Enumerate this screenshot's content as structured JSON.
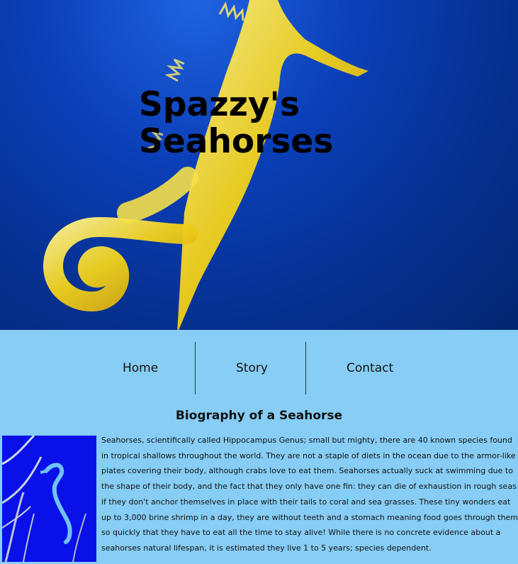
{
  "header": {
    "title_line1": "Spazzy's",
    "title_line2": "Seahorses",
    "hero_image": "yellow-seahorse-underwater"
  },
  "nav": {
    "items": [
      {
        "label": "Home"
      },
      {
        "label": "Story"
      },
      {
        "label": "Contact"
      }
    ]
  },
  "main": {
    "heading": "Biography of a Seahorse",
    "image": "blue-seahorse-coral",
    "paragraph": "Seahorses, scientifically called Hippocampus Genus; small but mighty, there are 40 known species found in tropical shallows throughout the world. They are not a staple of diets in the ocean due to the armor-like plates covering their body, although crabs love to eat them. Seahorses actually suck at swimming due to the shape of their body, and the fact that they only have one fin: they can die of exhaustion in rough seas if they don't anchor themselves in place with their tails to coral and sea grasses. These tiny wonders eat up to 3,000 brine shrimp in a day, they are without teeth and a stomach meaning food goes through them so quickly that they have to eat all the time to stay alive! While there is no concrete evidence about a seahorses natural lifespan, it is estimated they live 1 to 5 years; species dependent."
  },
  "colors": {
    "page_background": "#87cdf5",
    "hero_water": "#0b3fb8",
    "seahorse_yellow": "#f2d21a"
  }
}
